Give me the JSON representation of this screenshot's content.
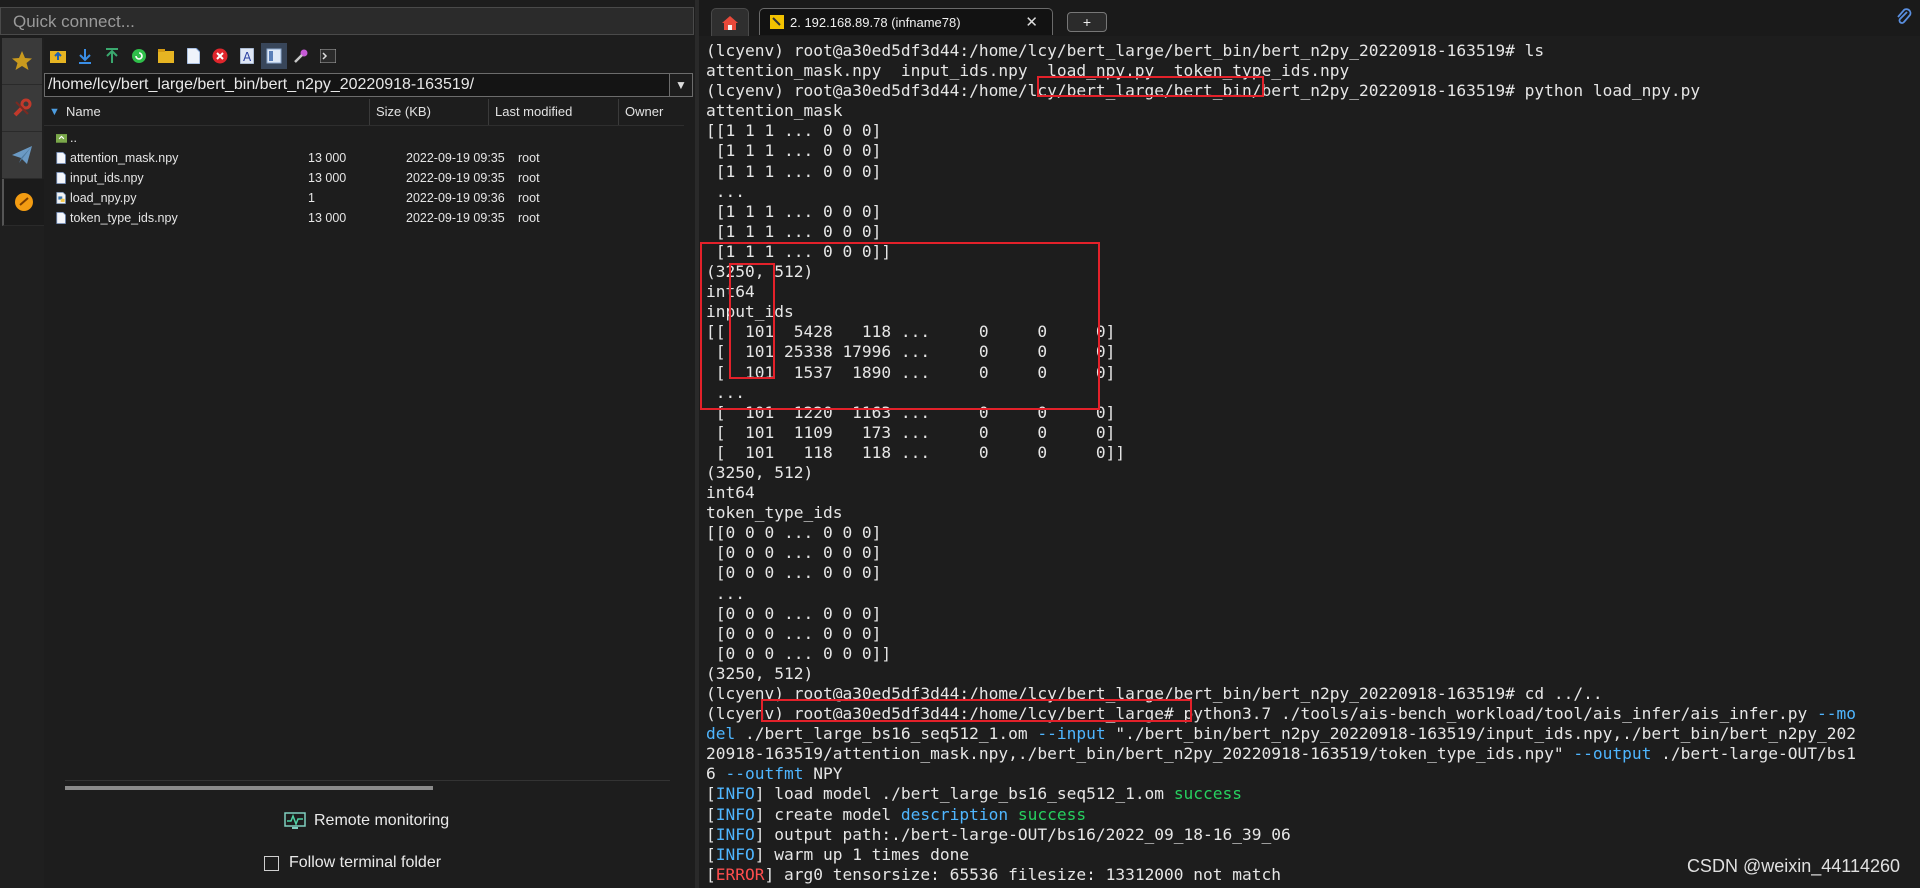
{
  "quick_connect": {
    "placeholder": "Quick connect..."
  },
  "sidebar": {
    "buttons": [
      {
        "name": "bookmarks",
        "icon": "star-icon"
      },
      {
        "name": "tools",
        "icon": "tools-icon"
      },
      {
        "name": "macros",
        "icon": "paper-plane-icon"
      },
      {
        "name": "sftp",
        "icon": "sftp-icon"
      }
    ]
  },
  "file_toolbar": {
    "buttons": [
      "parent-folder-icon",
      "download-icon",
      "upload-icon",
      "refresh-icon",
      "new-folder-icon",
      "new-file-icon",
      "delete-icon",
      "rename-icon",
      "follow-terminal-icon",
      "settings-icon",
      "terminal-icon"
    ]
  },
  "file_browser": {
    "path": "/home/lcy/bert_large/bert_bin/bert_n2py_20220918-163519/",
    "columns": {
      "name": "Name",
      "size": "Size (KB)",
      "modified": "Last modified",
      "owner": "Owner"
    },
    "rows": [
      {
        "name": "..",
        "size": "",
        "modified": "",
        "owner": "",
        "kind": "parent"
      },
      {
        "name": "attention_mask.npy",
        "size": "13 000",
        "modified": "2022-09-19 09:35",
        "owner": "root",
        "kind": "file"
      },
      {
        "name": "input_ids.npy",
        "size": "13 000",
        "modified": "2022-09-19 09:35",
        "owner": "root",
        "kind": "file"
      },
      {
        "name": "load_npy.py",
        "size": "1",
        "modified": "2022-09-19 09:36",
        "owner": "root",
        "kind": "python"
      },
      {
        "name": "token_type_ids.npy",
        "size": "13 000",
        "modified": "2022-09-19 09:35",
        "owner": "root",
        "kind": "file"
      }
    ]
  },
  "remote_monitoring": {
    "label": "Remote monitoring"
  },
  "follow_terminal": {
    "label": "Follow terminal folder",
    "checked": false
  },
  "tabs": {
    "home_icon": "home-icon",
    "session_label": "2. 192.168.89.78 (infname78)",
    "new_tab_label": "+"
  },
  "terminal": {
    "lines": [
      [
        [
          "",
          "(lcyenv) root@a30ed5df3d44:/home/lcy/bert_large/bert_bin/bert_n2py_20220918-163519# ls"
        ]
      ],
      [
        [
          "",
          "attention_mask.npy  input_ids.npy  load_npy.py  token_type_ids.npy"
        ]
      ],
      [
        [
          "",
          "(lcyenv) root@a30ed5df3d44:/home/lcy/bert_large/bert_bin/bert_n2py_20220918-163519# python load_npy.py"
        ]
      ],
      [
        [
          "",
          "attention_mask"
        ]
      ],
      [
        [
          "",
          "[[1 1 1 ... 0 0 0]"
        ]
      ],
      [
        [
          "",
          " [1 1 1 ... 0 0 0]"
        ]
      ],
      [
        [
          "",
          " [1 1 1 ... 0 0 0]"
        ]
      ],
      [
        [
          "",
          " ..."
        ]
      ],
      [
        [
          "",
          " [1 1 1 ... 0 0 0]"
        ]
      ],
      [
        [
          "",
          " [1 1 1 ... 0 0 0]"
        ]
      ],
      [
        [
          "",
          " [1 1 1 ... 0 0 0]]"
        ]
      ],
      [
        [
          "",
          "(3250, 512)"
        ]
      ],
      [
        [
          "",
          "int64"
        ]
      ],
      [
        [
          "",
          "input_ids"
        ]
      ],
      [
        [
          "",
          "[[  101  5428   118 ...     0     0     0]"
        ]
      ],
      [
        [
          "",
          " [  101 25338 17996 ...     0     0     0]"
        ]
      ],
      [
        [
          "",
          " [  101  1537  1890 ...     0     0     0]"
        ]
      ],
      [
        [
          "",
          " ..."
        ]
      ],
      [
        [
          "",
          " [  101  1220  1163 ...     0     0     0]"
        ]
      ],
      [
        [
          "",
          " [  101  1109   173 ...     0     0     0]"
        ]
      ],
      [
        [
          "",
          " [  101   118   118 ...     0     0     0]]"
        ]
      ],
      [
        [
          "",
          "(3250, 512)"
        ]
      ],
      [
        [
          "",
          "int64"
        ]
      ],
      [
        [
          "",
          "token_type_ids"
        ]
      ],
      [
        [
          "",
          "[[0 0 0 ... 0 0 0]"
        ]
      ],
      [
        [
          "",
          " [0 0 0 ... 0 0 0]"
        ]
      ],
      [
        [
          "",
          " [0 0 0 ... 0 0 0]"
        ]
      ],
      [
        [
          "",
          " ..."
        ]
      ],
      [
        [
          "",
          " [0 0 0 ... 0 0 0]"
        ]
      ],
      [
        [
          "",
          " [0 0 0 ... 0 0 0]"
        ]
      ],
      [
        [
          "",
          " [0 0 0 ... 0 0 0]]"
        ]
      ],
      [
        [
          "",
          "(3250, 512)"
        ]
      ],
      [
        [
          "",
          "(lcyenv) root@a30ed5df3d44:/home/lcy/bert_large/bert_bin/bert_n2py_20220918-163519# cd ../.."
        ]
      ],
      [
        [
          "",
          "(lcyenv) root@a30ed5df3d44:/home/lcy/bert_large# python3.7 ./tools/ais-bench_workload/tool/ais_infer/ais_infer.py "
        ],
        [
          "cy",
          "--mo"
        ]
      ],
      [
        [
          "cy",
          "del"
        ],
        [
          "",
          " ./bert_large_bs16_seq512_1.om "
        ],
        [
          "cy",
          "--input"
        ],
        [
          "",
          " \"./bert_bin/bert_n2py_20220918-163519/input_ids.npy,./bert_bin/bert_n2py_202"
        ]
      ],
      [
        [
          "",
          "20918-163519/attention_mask.npy,./bert_bin/bert_n2py_20220918-163519/token_type_ids.npy\" "
        ],
        [
          "cy",
          "--output"
        ],
        [
          "",
          " ./bert-large-OUT/bs1"
        ]
      ],
      [
        [
          "",
          "6 "
        ],
        [
          "cy",
          "--outfmt"
        ],
        [
          "",
          " NPY"
        ]
      ],
      [
        [
          "",
          "["
        ],
        [
          "cy",
          "INFO"
        ],
        [
          "",
          "] load model ./bert_large_bs16_seq512_1.om "
        ],
        [
          "gr",
          "success"
        ]
      ],
      [
        [
          "",
          "["
        ],
        [
          "cy",
          "INFO"
        ],
        [
          "",
          "] create model "
        ],
        [
          "cy",
          "description"
        ],
        [
          "",
          " "
        ],
        [
          "gr",
          "success"
        ]
      ],
      [
        [
          "",
          "["
        ],
        [
          "cy",
          "INFO"
        ],
        [
          "",
          "] output path:./bert-large-OUT/bs16/2022_09_18-16_39_06"
        ]
      ],
      [
        [
          "",
          "["
        ],
        [
          "cy",
          "INFO"
        ],
        [
          "",
          "] warm up 1 times done"
        ]
      ],
      [
        [
          "",
          "["
        ],
        [
          "rd",
          "ERROR"
        ],
        [
          "",
          "] arg0 tensorsize: 65536 filesize: 13312000 not match"
        ]
      ]
    ]
  },
  "watermark": "CSDN @weixin_44114260"
}
